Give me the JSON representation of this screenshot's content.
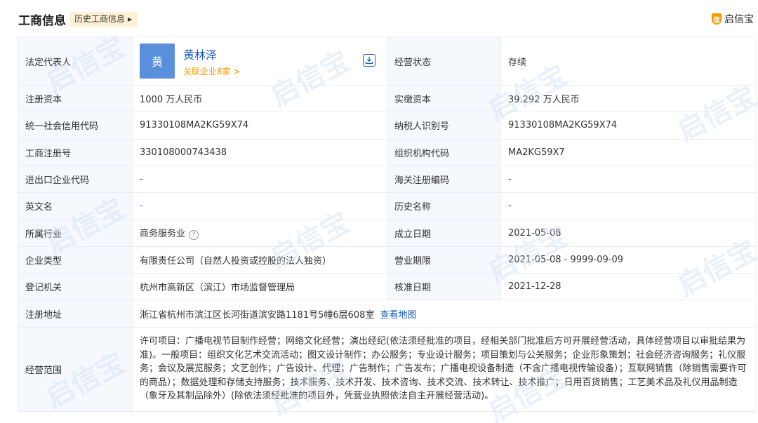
{
  "header": {
    "title": "工商信息",
    "history_button": "历史工商信息",
    "brand": "启信宝",
    "brand_icon_char": "信"
  },
  "rows": {
    "legal_rep_label": "法定代表人",
    "legal_rep_avatar": "黄",
    "legal_rep_name": "黄林泽",
    "legal_rep_related": "关联企业8家 >",
    "status_label": "经营状态",
    "status_value": "存续",
    "reg_capital_label": "注册资本",
    "reg_capital_value": "1000 万人民币",
    "paid_capital_label": "实缴资本",
    "paid_capital_value": "39.292 万人民币",
    "credit_code_label": "统一社会信用代码",
    "credit_code_value": "91330108MA2KG59X74",
    "tax_id_label": "纳税人识别号",
    "tax_id_value": "91330108MA2KG59X74",
    "reg_no_label": "工商注册号",
    "reg_no_value": "330108000743438",
    "org_code_label": "组织机构代码",
    "org_code_value": "MA2KG59X7",
    "import_export_label": "进出口企业代码",
    "import_export_value": "-",
    "customs_label": "海关注册编码",
    "customs_value": "-",
    "english_name_label": "英文名",
    "english_name_value": "-",
    "history_name_label": "历史名称",
    "history_name_value": "-",
    "industry_label": "所属行业",
    "industry_value": "商务服务业",
    "founded_label": "成立日期",
    "founded_value": "2021-05-08",
    "company_type_label": "企业类型",
    "company_type_value": "有限责任公司（自然人投资或控股的法人独资）",
    "term_label": "营业期限",
    "term_value": "2021-05-08 - 9999-09-09",
    "authority_label": "登记机关",
    "authority_value": "杭州市高新区（滨江）市场监督管理局",
    "approval_label": "核准日期",
    "approval_value": "2021-12-28",
    "address_label": "注册地址",
    "address_value": "浙江省杭州市滨江区长河街道滨安路1181号5幢6层608室",
    "map_link": "查看地图",
    "scope_label": "经营范围",
    "scope_value": "许可项目：广播电视节目制作经营；网络文化经营；演出经纪(依法须经批准的项目，经相关部门批准后方可开展经营活动，具体经营项目以审批结果为准)。一般项目：组织文化艺术交流活动；图文设计制作；办公服务；专业设计服务；项目策划与公关服务；企业形象策划；社会经济咨询服务；礼仪服务；会议及展览服务；文艺创作；广告设计、代理；广告制作；广告发布；广播电视设备制造（不含广播电视传输设备）；互联网销售（除销售需要许可的商品）；数据处理和存储支持服务；技术服务、技术开发、技术咨询、技术交流、技术转让、技术推广；日用百货销售；工艺美术品及礼仪用品制造（象牙及其制品除外）(除依法须经批准的项目外，凭营业执照依法自主开展经营活动)。"
  },
  "watermark_text": "启信宝",
  "colors": {
    "link": "#1a5db4",
    "accent": "#f39800",
    "label_bg": "#f5f8fd",
    "avatar_bg": "#5a8fdc",
    "border": "#e9edf3"
  }
}
